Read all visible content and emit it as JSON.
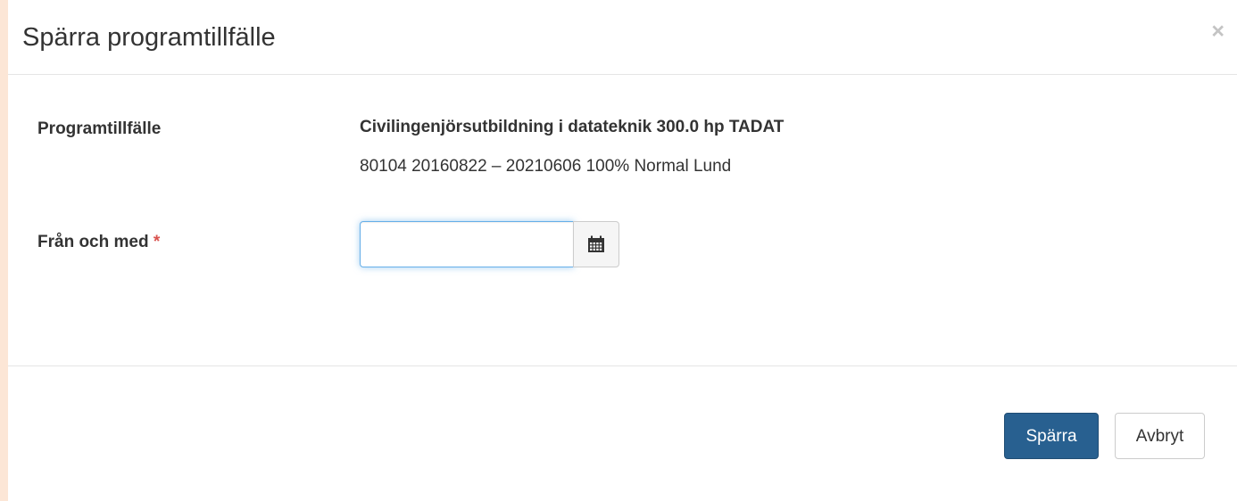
{
  "dialog": {
    "title": "Spärra programtillfälle",
    "close_symbol": "×"
  },
  "form": {
    "program_label": "Programtillfälle",
    "program_name": "Civilingenjörsutbildning i datateknik 300.0 hp TADAT",
    "program_details": "80104 20160822 – 20210606 100% Normal Lund",
    "from_label": "Från och med",
    "required_marker": "*",
    "from_value": "",
    "calendar_icon": "calendar-icon"
  },
  "footer": {
    "confirm_label": "Spärra",
    "cancel_label": "Avbryt"
  },
  "colors": {
    "primary": "#286090",
    "required": "#d9534f",
    "focus_border": "#66afe9",
    "page_background": "#fce6d6"
  }
}
